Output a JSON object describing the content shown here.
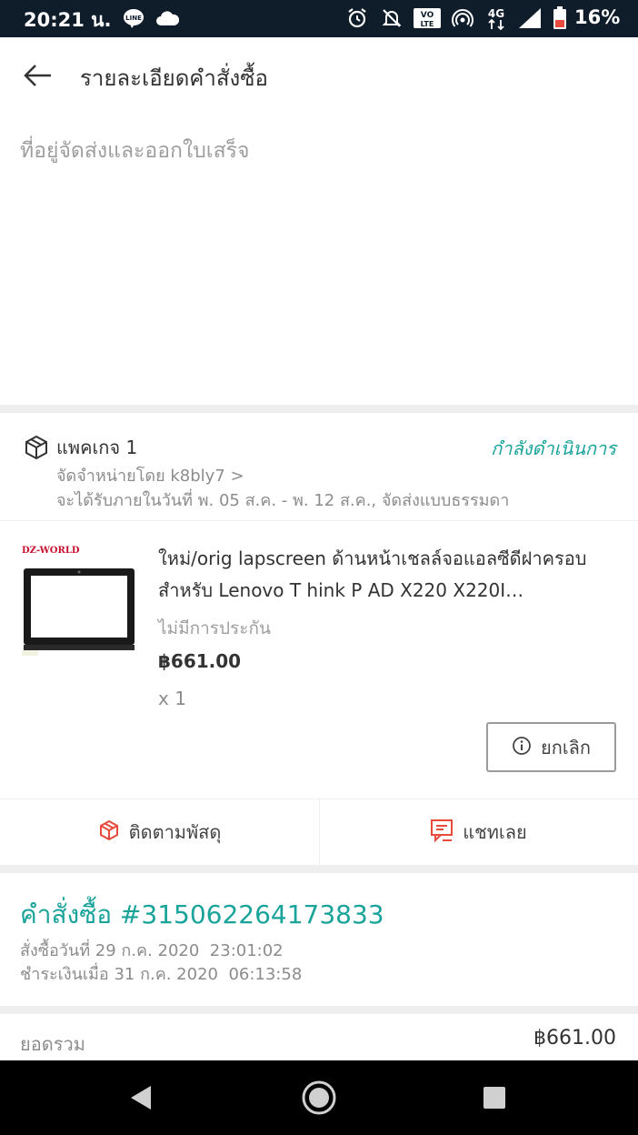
{
  "status_bar": {
    "time": "20:21 น.",
    "battery": "16%",
    "icons": [
      "line-icon",
      "cloud-icon",
      "alarm-icon",
      "mute-icon",
      "volte-icon",
      "hotspot-icon",
      "4g-icon",
      "signal-icon",
      "battery-icon"
    ],
    "volte_label": "VO LTE",
    "network_label": "4G"
  },
  "app_bar": {
    "title": "รายละเอียดคำสั่งซื้อ"
  },
  "address_section": {
    "heading": "ที่อยู่จัดส่งและออกใบเสร็จ"
  },
  "package": {
    "name": "แพคเกจ 1",
    "status": "กำลังดำเนินการ",
    "seller": "จัดจำหน่ายโดย k8bly7 >",
    "delivery": "จะได้รับภายในวันที่ พ. 05 ส.ค. - พ. 12 ส.ค., จัดส่งแบบธรรมดา",
    "product": {
      "brand_logo": "DZ-WORLD",
      "title": "ใหม่/orig lapscreen ด้านหน้าเชลล์จอแอลซีดีฝาครอบสำหรับ Lenovo T hink P AD X220 X220I…",
      "warranty": "ไม่มีการประกัน",
      "price": "฿661.00",
      "quantity": "x 1"
    },
    "cancel_label": "ยกเลิก"
  },
  "actions": {
    "track_label": "ติดตามพัสดุ",
    "chat_label": "แชทเลย"
  },
  "order": {
    "number": "คำสั่งซื้อ #315062264173833",
    "ordered_at": "สั่งซื้อวันที่ 29 ก.ค. 2020  23:01:02",
    "paid_at": "ชำระเงินเมื่อ 31 ก.ค. 2020  06:13:58"
  },
  "summary": {
    "total_label": "ยอดรวม",
    "total_value": "฿661.00"
  },
  "colors": {
    "accent": "#1aa39a",
    "action_icon": "#e84a3c",
    "status_bar": "#0f1d2b"
  }
}
